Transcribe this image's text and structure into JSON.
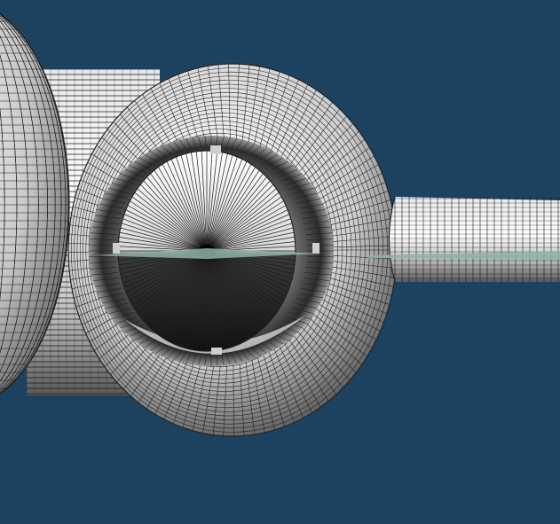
{
  "scene": {
    "background_color": "#1d4260",
    "mesh_line_color": "#1a1a1a",
    "surface_light": "#f4f4f4",
    "surface_mid": "#9a9a9a",
    "surface_dark": "#2a2a2a",
    "cut_plane_color": "#8fb3a4"
  },
  "objects": [
    {
      "id": "left-sphere",
      "icon": "sphere-mesh"
    },
    {
      "id": "connector-cylinder",
      "icon": "cylinder-mesh"
    },
    {
      "id": "torus",
      "icon": "torus-mesh"
    },
    {
      "id": "inner-disc",
      "icon": "radial-mesh"
    },
    {
      "id": "right-cylinder",
      "icon": "cylinder-mesh"
    },
    {
      "id": "section-plane",
      "icon": "plane"
    }
  ]
}
